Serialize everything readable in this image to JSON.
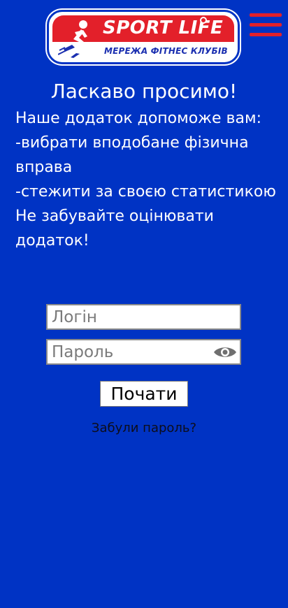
{
  "header": {
    "logo": {
      "title": "SPORT LIFE",
      "subtitle": "МЕРЕЖА ФІТНЕС КЛУБІВ",
      "icon": "runner-icon"
    },
    "menu_icon": "hamburger-menu-icon"
  },
  "welcome": {
    "title": "Ласкаво просимо!",
    "lines": [
      "Наше додаток допоможе вам:",
      "-вибрати вподобане фізична",
      "вправа",
      "-стежити за своєю статистикою",
      "Не забувайте оцінювати",
      "додаток!"
    ]
  },
  "form": {
    "login": {
      "placeholder": "Логін",
      "value": ""
    },
    "password": {
      "placeholder": "Пароль",
      "value": "",
      "toggle_icon": "eye-icon"
    },
    "submit_label": "Почати",
    "forgot_label": "Забули пароль?"
  },
  "colors": {
    "background": "#0033c4",
    "brand_red": "#e3202a",
    "brand_blue": "#1b2fb0",
    "text_light": "#ffffff",
    "text_dark": "#0d0d1a"
  }
}
